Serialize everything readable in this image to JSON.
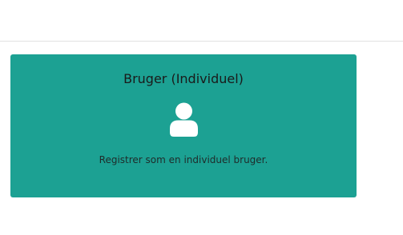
{
  "card": {
    "title": "Bruger (Individuel)",
    "description": "Registrer som en individuel bruger.",
    "icon": "user-icon",
    "background_color": "#1ca193"
  }
}
